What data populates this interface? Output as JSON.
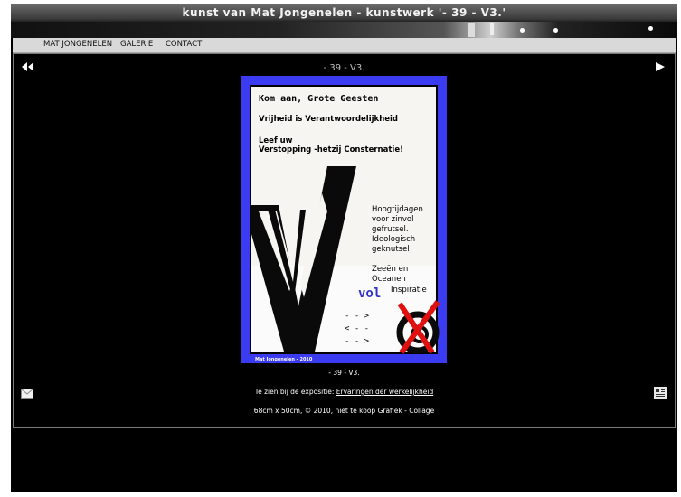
{
  "header": {
    "title": "kunst van Mat Jongenelen - kunstwerk '- 39 - V3.'"
  },
  "nav": {
    "items": [
      "MAT JONGENELEN",
      "GALERIE",
      "CONTACT"
    ]
  },
  "viewer": {
    "title": "- 39 - V3.",
    "prev_icon": "double-left-arrow-icon",
    "next_icon": "right-arrow-icon",
    "caption": "- 39 - V3.",
    "exposition_prefix": "Te zien bij de expositie: ",
    "exposition_link": "Ervaringen der werkelijkheid",
    "specs": "68cm x 50cm, © 2010, niet te koop Grafiek - Collage",
    "mail_icon": "envelope-icon",
    "share_icon": "share-icon"
  },
  "artwork": {
    "line1": "Kom aan, Grote Geesten",
    "line2": "Vrijheid is Verantwoordelijkheid",
    "line3a": "Leef uw",
    "line3b": "Verstopping -hetzij Consternatie!",
    "side1": "Hoogtijdagen",
    "side2": "voor zinvol",
    "side3": "gefrutsel.",
    "side4": "Ideologisch",
    "side5": "geknutsel",
    "side6": "Zeeën en",
    "side7": "Oceanen",
    "vol": "vol",
    "side8": "Inspiratie",
    "arrow1": "- - >",
    "arrow2": "< - -",
    "arrow3": "- - >",
    "signature": "Mat Jongenelen - 2010",
    "colors": {
      "frame": "#3b3bf2",
      "paper": "#f7f5f2",
      "vol": "#3333cc",
      "cross": "#e01010"
    }
  }
}
